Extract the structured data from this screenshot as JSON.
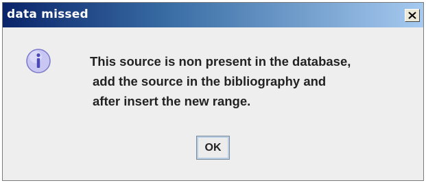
{
  "window": {
    "title": "data missed",
    "close_label": "X"
  },
  "dialog": {
    "icon": "information-icon",
    "message_lines": [
      "This source is non present in the database,",
      "add the source in the bibliography and",
      "after insert the new range."
    ],
    "ok_label": "OK"
  },
  "colors": {
    "title_bar_start": "#0a246a",
    "title_bar_end": "#a6caf0",
    "dialog_background": "#eeeeee",
    "icon_fill": "#c8c6f2",
    "icon_glyph": "#4b47b3"
  }
}
